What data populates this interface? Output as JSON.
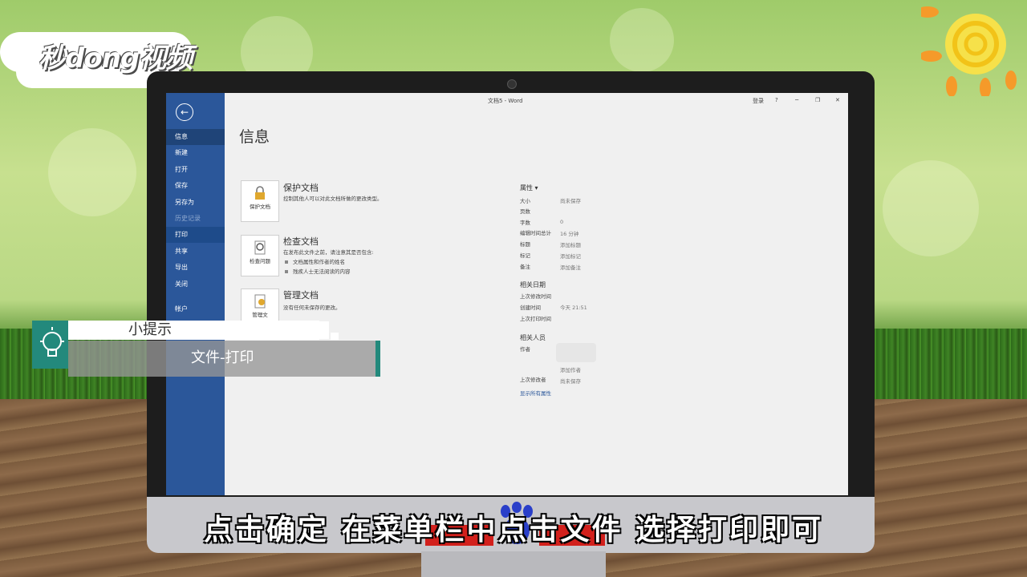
{
  "branding": {
    "logo_text": "秒dong视频"
  },
  "window": {
    "doc_title": "文档5 - Word",
    "login_label": "登录",
    "help_label": "?",
    "minimize": "─",
    "restore": "❐",
    "close": "✕"
  },
  "sidebar": {
    "back_icon": "←",
    "items": [
      {
        "label": "信息"
      },
      {
        "label": "新建"
      },
      {
        "label": "打开"
      },
      {
        "label": "保存"
      },
      {
        "label": "另存为"
      },
      {
        "label": "历史记录"
      },
      {
        "label": "打印"
      },
      {
        "label": "共享"
      },
      {
        "label": "导出"
      },
      {
        "label": "关闭"
      },
      {
        "label": "帐户"
      }
    ]
  },
  "info": {
    "title": "信息",
    "protect": {
      "card_label": "保护文档",
      "title": "保护文档",
      "desc": "控制其他人可以对此文档所做的更改类型。"
    },
    "inspect": {
      "card_label": "检查问题",
      "title": "检查文档",
      "desc": "在发布此文件之前，请注意其是否包含:",
      "bullets": [
        "文档属性和作者的姓名",
        "残疾人士无法阅读的内容"
      ]
    },
    "manage": {
      "card_label": "管理文",
      "title": "管理文档",
      "desc": "没有任何未保存的更改。"
    }
  },
  "properties": {
    "header": "属性 ▾",
    "rows": [
      {
        "label": "大小",
        "value": "尚未保存"
      },
      {
        "label": "页数",
        "value": ""
      },
      {
        "label": "字数",
        "value": "0"
      },
      {
        "label": "编辑时间总计",
        "value": "16 分钟"
      },
      {
        "label": "标题",
        "value": "添加标题"
      },
      {
        "label": "标记",
        "value": "添加标记"
      },
      {
        "label": "备注",
        "value": "添加备注"
      }
    ],
    "dates_header": "相关日期",
    "dates": [
      {
        "label": "上次修改时间",
        "value": ""
      },
      {
        "label": "创建时间",
        "value": "今天 21:51"
      },
      {
        "label": "上次打印时间",
        "value": ""
      }
    ],
    "people_header": "相关人员",
    "author_label": "作者",
    "add_author": "添加作者",
    "last_modified_by_label": "上次修改者",
    "last_modified_by_value": "尚未保存",
    "show_all": "显示所有属性"
  },
  "tip": {
    "title": "小提示",
    "text": "文件-打印"
  },
  "subtitle": "点击确定 在菜单栏中点击文件 选择打印即可"
}
